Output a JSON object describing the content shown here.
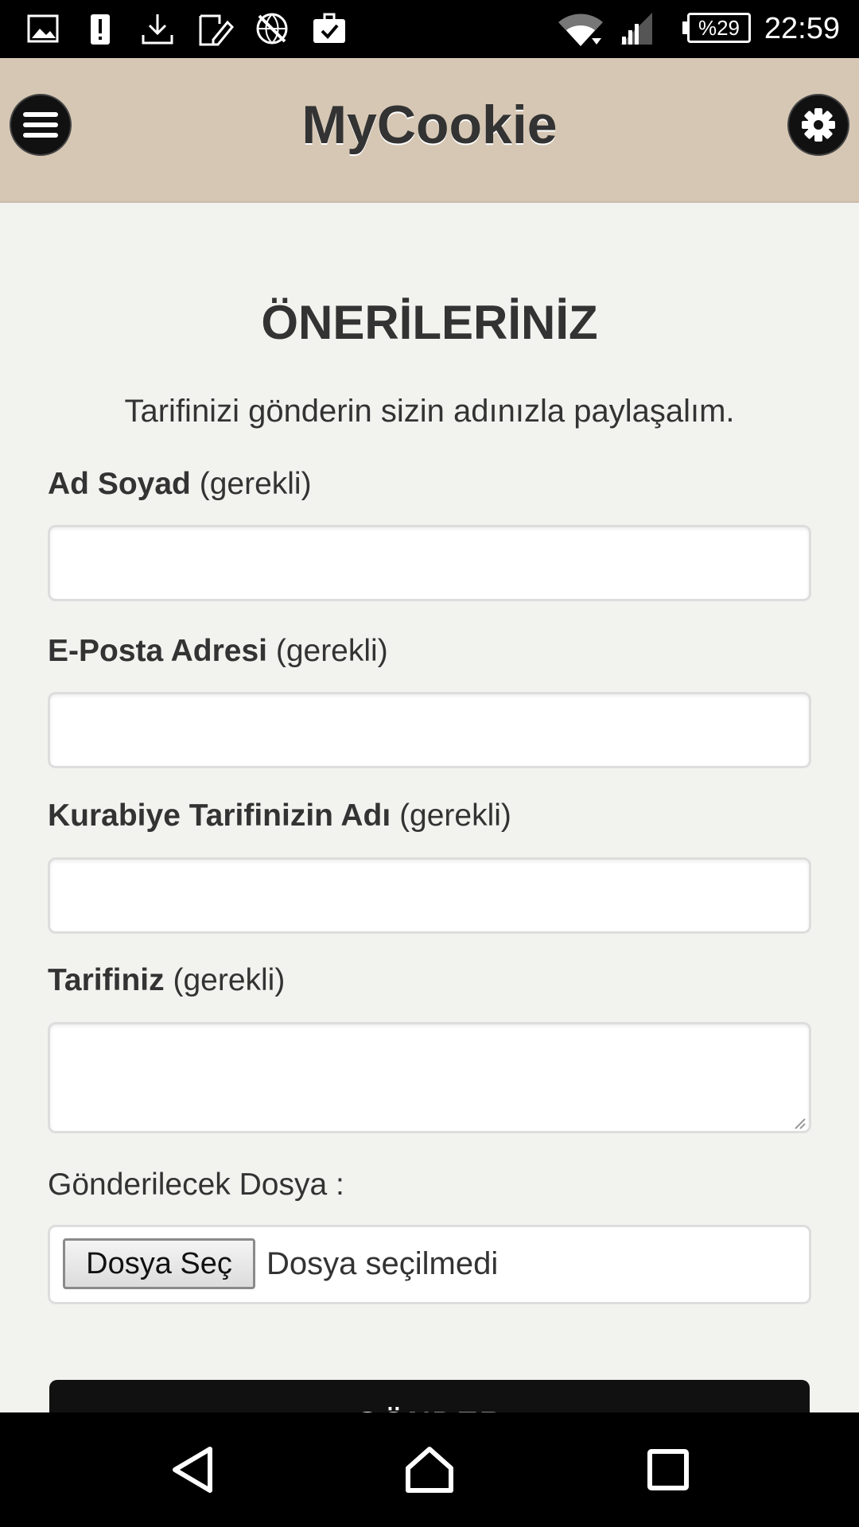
{
  "status_bar": {
    "battery": "%29",
    "time": "22:59",
    "icons": [
      "image-icon",
      "alert-icon",
      "download-icon",
      "edit-note-icon",
      "no-vpn-icon",
      "briefcase-check-icon",
      "wifi-icon",
      "signal-icon",
      "battery-icon"
    ]
  },
  "header": {
    "title": "MyCookie",
    "menu_icon": "hamburger-icon",
    "settings_icon": "gear-icon"
  },
  "form": {
    "title": "ÖNERİLERİNİZ",
    "subtitle": "Tarifinizi gönderin sizin adınızla paylaşalım.",
    "required_suffix": "(gerekli)",
    "fields": [
      {
        "label": "Ad Soyad",
        "value": ""
      },
      {
        "label": "E-Posta Adresi",
        "value": ""
      },
      {
        "label": "Kurabiye Tarifinizin Adı",
        "value": ""
      },
      {
        "label": "Tarifiniz",
        "value": ""
      }
    ],
    "file_label": "Gönderilecek Dosya :",
    "file_button": "Dosya Seç",
    "file_status": "Dosya seçilmedi",
    "submit_label": "GÖNDER"
  },
  "nav_bar": {
    "icons": [
      "back-icon",
      "home-icon",
      "recents-icon"
    ]
  },
  "colors": {
    "header_bg": "#d6c7b4",
    "page_bg": "#f2f2ef",
    "text": "#333333",
    "button_dark": "#111111"
  }
}
